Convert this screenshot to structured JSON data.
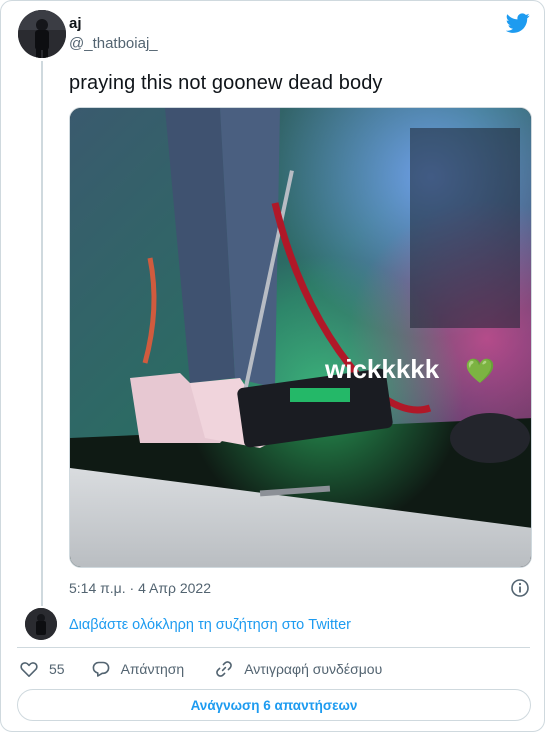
{
  "author": {
    "display_name": "aj",
    "handle": "@_thatboiaj_"
  },
  "tweet": {
    "text": "praying this not goonew dead body",
    "media_overlay_text": "wickkkkk",
    "media_overlay_emoji": "💚",
    "timestamp": "5:14 π.μ. · 4 Απρ 2022"
  },
  "conversation_link": "Διαβάστε ολόκληρη τη συζήτηση στο Twitter",
  "actions": {
    "like_count": "55",
    "reply_label": "Απάντηση",
    "copy_link_label": "Αντιγραφή συνδέσμου"
  },
  "read_replies_label": "Ανάγνωση 6 απαντήσεων",
  "colors": {
    "accent": "#1d9bf0",
    "text_primary": "#0f1419",
    "text_secondary": "#536471",
    "border": "#cfd9de"
  },
  "icons": [
    "twitter-bird-icon",
    "info-icon",
    "heart-icon",
    "reply-bubble-icon",
    "link-icon"
  ]
}
